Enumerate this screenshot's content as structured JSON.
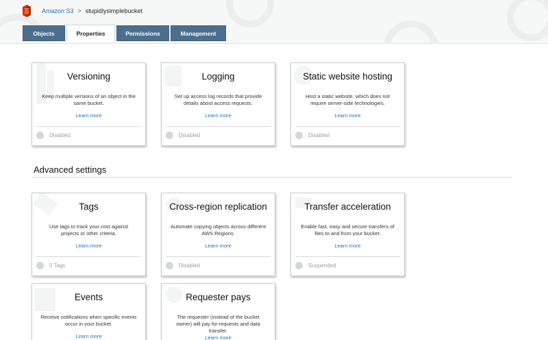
{
  "breadcrumb": {
    "service": "Amazon S3",
    "separator": ">",
    "bucket": "stupidlysimplebucket"
  },
  "tabs": [
    {
      "label": "Objects",
      "active": false
    },
    {
      "label": "Properties",
      "active": true
    },
    {
      "label": "Permissions",
      "active": false
    },
    {
      "label": "Management",
      "active": false
    }
  ],
  "cards": {
    "versioning": {
      "title": "Versioning",
      "description": "Keep multiple versions of an object in the same bucket.",
      "link": "Learn more",
      "status": "Disabled"
    },
    "logging": {
      "title": "Logging",
      "description": "Set up access log records that provide details about access requests.",
      "link": "Learn more",
      "status": "Disabled"
    },
    "static_website": {
      "title": "Static website hosting",
      "description": "Host a static website, which does not require server-side technologies.",
      "link": "Learn more",
      "status": "Disabled"
    }
  },
  "advanced": {
    "title": "Advanced settings",
    "cards": {
      "tags": {
        "title": "Tags",
        "description": "Use tags to track your cost against projects or other criteria.",
        "link": "Learn more",
        "status": "0 Tags"
      },
      "cross_region": {
        "title": "Cross-region replication",
        "description": "Automate copying objects across different AWS Regions.",
        "link": "Learn more",
        "status": "Disabled"
      },
      "transfer_accel": {
        "title": "Transfer acceleration",
        "description": "Enable fast, easy and secure transfers of files to and from your bucket.",
        "link": "Learn more",
        "status": "Suspended"
      },
      "events": {
        "title": "Events",
        "description": "Receive notifications when specific events occur in your bucket.",
        "link": "Learn more"
      },
      "requester_pays": {
        "title": "Requester pays",
        "description": "The requester (instead of the bucket owner) will pay for requests and data transfer.",
        "link": "Learn more"
      }
    }
  },
  "colors": {
    "tab_bg": "#4b6e8d",
    "link": "#1a73c7",
    "logo": "#d13212"
  }
}
